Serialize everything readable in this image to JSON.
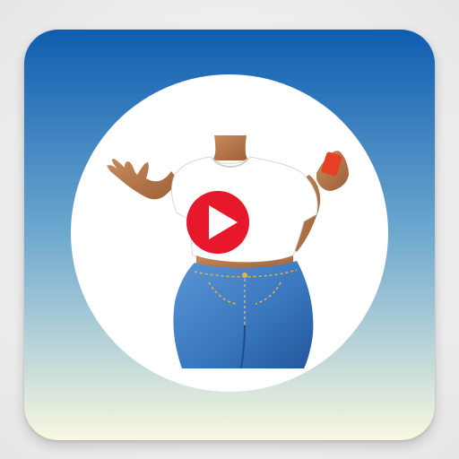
{
  "app_icon": {
    "icon_name": "fashion-model-video-icon",
    "colors": {
      "gradient_top": "#0f5db0",
      "gradient_mid": "#6ea9cf",
      "gradient_bottom": "#f8f8e0",
      "circle": "#ffffff",
      "shirt": "#ffffff",
      "skin": "#b87a4f",
      "jeans": "#3a78bf",
      "play_button": "#e8182c",
      "play_glyph": "#ffffff",
      "cup": "#e54026",
      "nails": "#b5121b"
    }
  }
}
